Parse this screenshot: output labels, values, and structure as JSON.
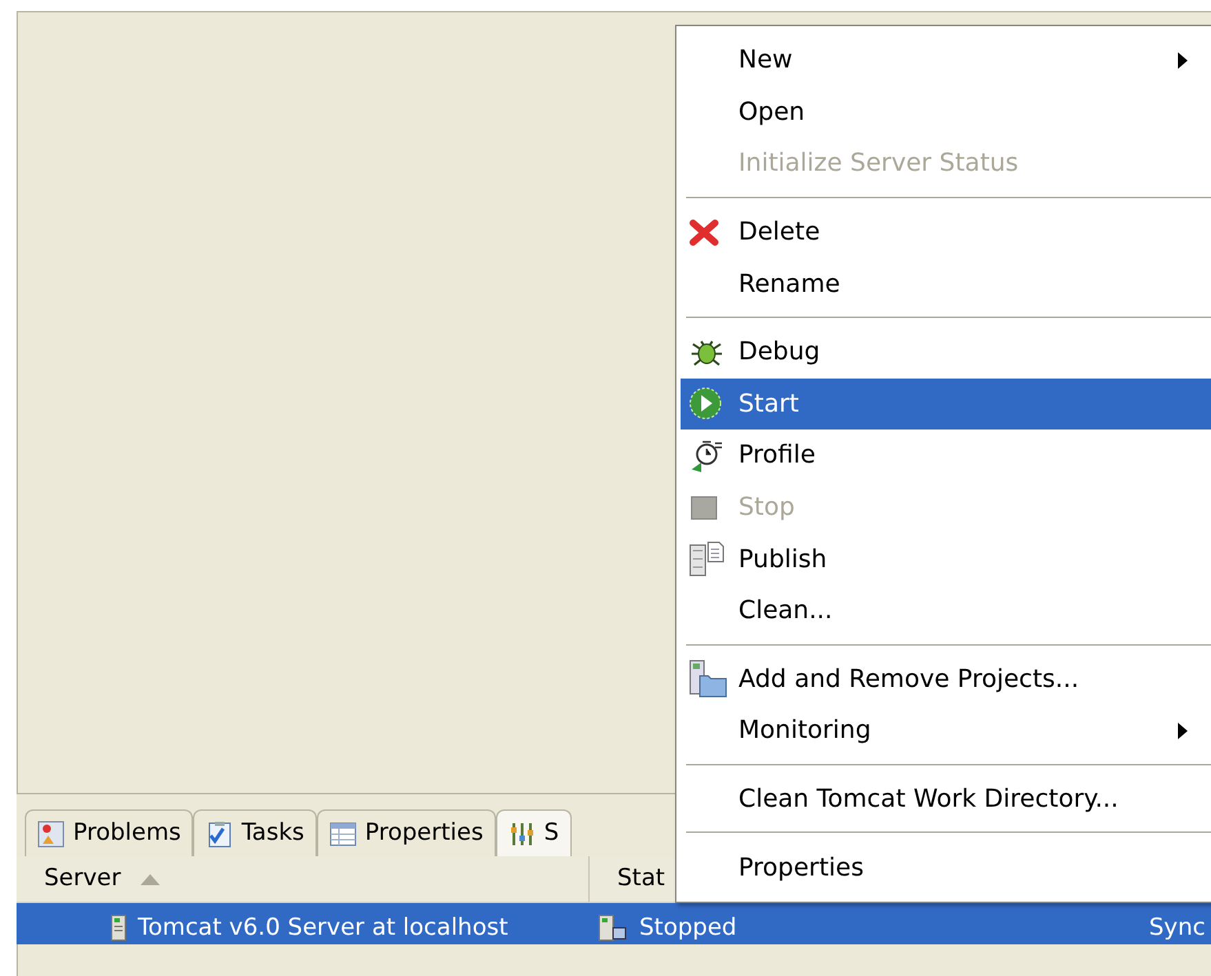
{
  "view_tabs": [
    {
      "label": "Problems",
      "selected": false
    },
    {
      "label": "Tasks",
      "selected": false
    },
    {
      "label": "Properties",
      "selected": false
    },
    {
      "label": "S",
      "selected": true
    }
  ],
  "table": {
    "columns": [
      "Server",
      "Stat"
    ],
    "rows": [
      {
        "cells": [
          "Tomcat v6.0 Server at localhost",
          "Stopped",
          "Sync"
        ],
        "selected": true
      }
    ]
  },
  "context_menu": {
    "items": [
      {
        "kind": "item",
        "label": "New",
        "submenu": true,
        "disabled": false,
        "selected": false
      },
      {
        "kind": "item",
        "label": "Open",
        "disabled": false,
        "selected": false
      },
      {
        "kind": "item",
        "label": "Initialize Server Status",
        "disabled": true,
        "selected": false
      },
      {
        "kind": "separator"
      },
      {
        "kind": "item",
        "label": "Delete",
        "disabled": false,
        "selected": false
      },
      {
        "kind": "item",
        "label": "Rename",
        "disabled": false,
        "selected": false
      },
      {
        "kind": "separator"
      },
      {
        "kind": "item",
        "label": "Debug",
        "disabled": false,
        "selected": false
      },
      {
        "kind": "item",
        "label": "Start",
        "disabled": false,
        "selected": true
      },
      {
        "kind": "item",
        "label": "Profile",
        "disabled": false,
        "selected": false
      },
      {
        "kind": "item",
        "label": "Stop",
        "disabled": true,
        "selected": false
      },
      {
        "kind": "item",
        "label": "Publish",
        "disabled": false,
        "selected": false
      },
      {
        "kind": "item",
        "label": "Clean...",
        "disabled": false,
        "selected": false
      },
      {
        "kind": "separator"
      },
      {
        "kind": "item",
        "label": "Add and Remove Projects...",
        "disabled": false,
        "selected": false
      },
      {
        "kind": "item",
        "label": "Monitoring",
        "submenu": true,
        "disabled": false,
        "selected": false
      },
      {
        "kind": "separator"
      },
      {
        "kind": "item",
        "label": "Clean Tomcat Work Directory...",
        "disabled": false,
        "selected": false
      },
      {
        "kind": "separator"
      },
      {
        "kind": "item",
        "label": "Properties",
        "disabled": false,
        "selected": false
      }
    ]
  }
}
